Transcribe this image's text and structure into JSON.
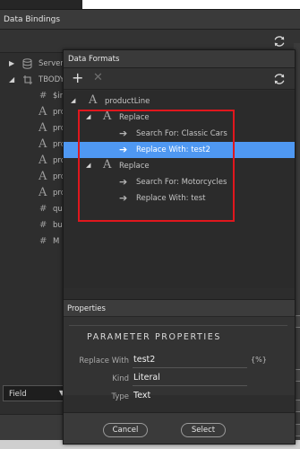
{
  "data_bindings": {
    "title": "Data Bindings",
    "tree": [
      {
        "icon": "database-icon",
        "label": "Server"
      },
      {
        "icon": "table-loop-icon",
        "label": "TBODY"
      },
      {
        "icon": "hash-icon",
        "label": "$ir"
      },
      {
        "icon": "text-icon",
        "label": "pro"
      },
      {
        "icon": "text-icon",
        "label": "pro"
      },
      {
        "icon": "text-icon",
        "label": "pro"
      },
      {
        "icon": "text-icon",
        "label": "pro"
      },
      {
        "icon": "text-icon",
        "label": "pro"
      },
      {
        "icon": "text-icon",
        "label": "pro"
      },
      {
        "icon": "hash-icon",
        "label": "qu"
      },
      {
        "icon": "hash-icon",
        "label": "bu"
      },
      {
        "icon": "hash-icon",
        "label": "M"
      }
    ],
    "field_select": {
      "value": "Field"
    }
  },
  "data_formats": {
    "title": "Data Formats",
    "toolbar": {
      "add": "+",
      "remove": "✕"
    },
    "tree": {
      "root": "productLine",
      "groups": [
        {
          "label": "Replace",
          "items": [
            "Search For: Classic Cars",
            "Replace With: test2"
          ]
        },
        {
          "label": "Replace",
          "items": [
            "Search For: Motorcycles",
            "Replace With: test"
          ]
        }
      ]
    },
    "properties": {
      "title": "Properties",
      "section_heading": "PARAMETER PROPERTIES",
      "rows": [
        {
          "label": "Replace With",
          "value": "test2"
        },
        {
          "label": "Kind",
          "value": "Literal"
        },
        {
          "label": "Type",
          "value": "Text"
        }
      ],
      "dynamic_icon": "{%}"
    },
    "buttons": {
      "cancel": "Cancel",
      "select": "Select"
    }
  }
}
